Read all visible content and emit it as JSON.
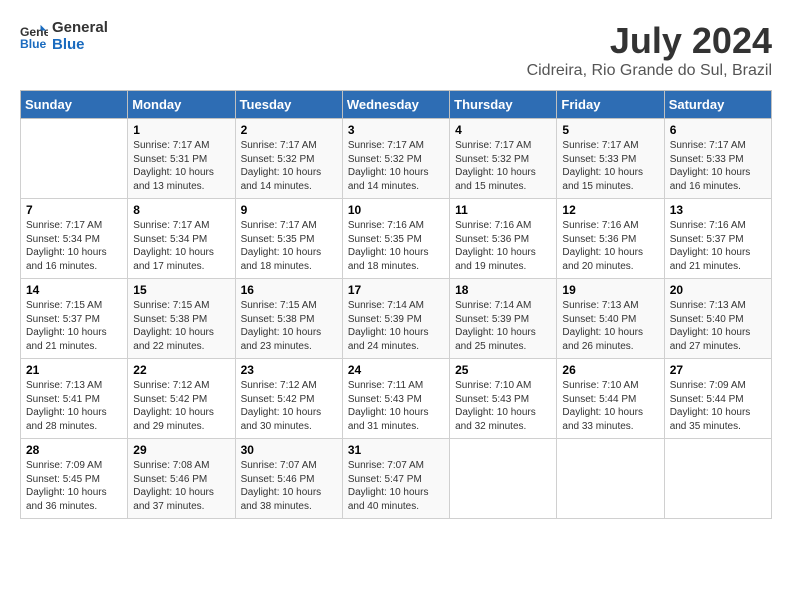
{
  "logo": {
    "line1": "General",
    "line2": "Blue"
  },
  "title": "July 2024",
  "location": "Cidreira, Rio Grande do Sul, Brazil",
  "days_of_week": [
    "Sunday",
    "Monday",
    "Tuesday",
    "Wednesday",
    "Thursday",
    "Friday",
    "Saturday"
  ],
  "weeks": [
    [
      {
        "day": "",
        "info": ""
      },
      {
        "day": "1",
        "info": "Sunrise: 7:17 AM\nSunset: 5:31 PM\nDaylight: 10 hours\nand 13 minutes."
      },
      {
        "day": "2",
        "info": "Sunrise: 7:17 AM\nSunset: 5:32 PM\nDaylight: 10 hours\nand 14 minutes."
      },
      {
        "day": "3",
        "info": "Sunrise: 7:17 AM\nSunset: 5:32 PM\nDaylight: 10 hours\nand 14 minutes."
      },
      {
        "day": "4",
        "info": "Sunrise: 7:17 AM\nSunset: 5:32 PM\nDaylight: 10 hours\nand 15 minutes."
      },
      {
        "day": "5",
        "info": "Sunrise: 7:17 AM\nSunset: 5:33 PM\nDaylight: 10 hours\nand 15 minutes."
      },
      {
        "day": "6",
        "info": "Sunrise: 7:17 AM\nSunset: 5:33 PM\nDaylight: 10 hours\nand 16 minutes."
      }
    ],
    [
      {
        "day": "7",
        "info": "Sunrise: 7:17 AM\nSunset: 5:34 PM\nDaylight: 10 hours\nand 16 minutes."
      },
      {
        "day": "8",
        "info": "Sunrise: 7:17 AM\nSunset: 5:34 PM\nDaylight: 10 hours\nand 17 minutes."
      },
      {
        "day": "9",
        "info": "Sunrise: 7:17 AM\nSunset: 5:35 PM\nDaylight: 10 hours\nand 18 minutes."
      },
      {
        "day": "10",
        "info": "Sunrise: 7:16 AM\nSunset: 5:35 PM\nDaylight: 10 hours\nand 18 minutes."
      },
      {
        "day": "11",
        "info": "Sunrise: 7:16 AM\nSunset: 5:36 PM\nDaylight: 10 hours\nand 19 minutes."
      },
      {
        "day": "12",
        "info": "Sunrise: 7:16 AM\nSunset: 5:36 PM\nDaylight: 10 hours\nand 20 minutes."
      },
      {
        "day": "13",
        "info": "Sunrise: 7:16 AM\nSunset: 5:37 PM\nDaylight: 10 hours\nand 21 minutes."
      }
    ],
    [
      {
        "day": "14",
        "info": "Sunrise: 7:15 AM\nSunset: 5:37 PM\nDaylight: 10 hours\nand 21 minutes."
      },
      {
        "day": "15",
        "info": "Sunrise: 7:15 AM\nSunset: 5:38 PM\nDaylight: 10 hours\nand 22 minutes."
      },
      {
        "day": "16",
        "info": "Sunrise: 7:15 AM\nSunset: 5:38 PM\nDaylight: 10 hours\nand 23 minutes."
      },
      {
        "day": "17",
        "info": "Sunrise: 7:14 AM\nSunset: 5:39 PM\nDaylight: 10 hours\nand 24 minutes."
      },
      {
        "day": "18",
        "info": "Sunrise: 7:14 AM\nSunset: 5:39 PM\nDaylight: 10 hours\nand 25 minutes."
      },
      {
        "day": "19",
        "info": "Sunrise: 7:13 AM\nSunset: 5:40 PM\nDaylight: 10 hours\nand 26 minutes."
      },
      {
        "day": "20",
        "info": "Sunrise: 7:13 AM\nSunset: 5:40 PM\nDaylight: 10 hours\nand 27 minutes."
      }
    ],
    [
      {
        "day": "21",
        "info": "Sunrise: 7:13 AM\nSunset: 5:41 PM\nDaylight: 10 hours\nand 28 minutes."
      },
      {
        "day": "22",
        "info": "Sunrise: 7:12 AM\nSunset: 5:42 PM\nDaylight: 10 hours\nand 29 minutes."
      },
      {
        "day": "23",
        "info": "Sunrise: 7:12 AM\nSunset: 5:42 PM\nDaylight: 10 hours\nand 30 minutes."
      },
      {
        "day": "24",
        "info": "Sunrise: 7:11 AM\nSunset: 5:43 PM\nDaylight: 10 hours\nand 31 minutes."
      },
      {
        "day": "25",
        "info": "Sunrise: 7:10 AM\nSunset: 5:43 PM\nDaylight: 10 hours\nand 32 minutes."
      },
      {
        "day": "26",
        "info": "Sunrise: 7:10 AM\nSunset: 5:44 PM\nDaylight: 10 hours\nand 33 minutes."
      },
      {
        "day": "27",
        "info": "Sunrise: 7:09 AM\nSunset: 5:44 PM\nDaylight: 10 hours\nand 35 minutes."
      }
    ],
    [
      {
        "day": "28",
        "info": "Sunrise: 7:09 AM\nSunset: 5:45 PM\nDaylight: 10 hours\nand 36 minutes."
      },
      {
        "day": "29",
        "info": "Sunrise: 7:08 AM\nSunset: 5:46 PM\nDaylight: 10 hours\nand 37 minutes."
      },
      {
        "day": "30",
        "info": "Sunrise: 7:07 AM\nSunset: 5:46 PM\nDaylight: 10 hours\nand 38 minutes."
      },
      {
        "day": "31",
        "info": "Sunrise: 7:07 AM\nSunset: 5:47 PM\nDaylight: 10 hours\nand 40 minutes."
      },
      {
        "day": "",
        "info": ""
      },
      {
        "day": "",
        "info": ""
      },
      {
        "day": "",
        "info": ""
      }
    ]
  ]
}
